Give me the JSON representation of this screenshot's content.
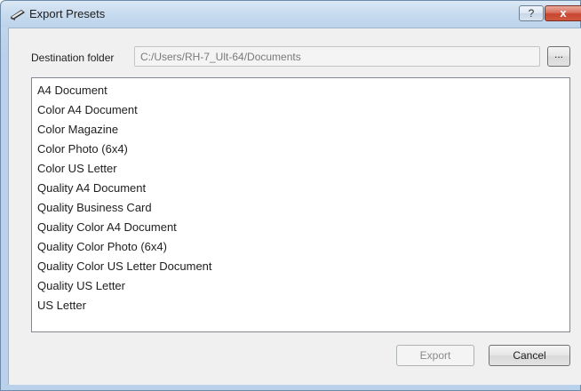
{
  "window": {
    "title": "Export Presets",
    "icon": "scanner-icon",
    "help_label": "?",
    "close_label": "x",
    "frame_color": "#b9d1ea"
  },
  "destination": {
    "label": "Destination folder",
    "value": "C:/Users/RH-7_Ult-64/Documents",
    "browse_label": "..."
  },
  "presets": [
    "A4 Document",
    "Color A4 Document",
    "Color Magazine",
    "Color Photo (6x4)",
    "Color US Letter",
    "Quality A4 Document",
    "Quality Business Card",
    "Quality Color A4 Document",
    "Quality Color Photo (6x4)",
    "Quality Color US Letter Document",
    "Quality US Letter",
    "US Letter"
  ],
  "buttons": {
    "export_label": "Export",
    "export_enabled": false,
    "cancel_label": "Cancel"
  }
}
